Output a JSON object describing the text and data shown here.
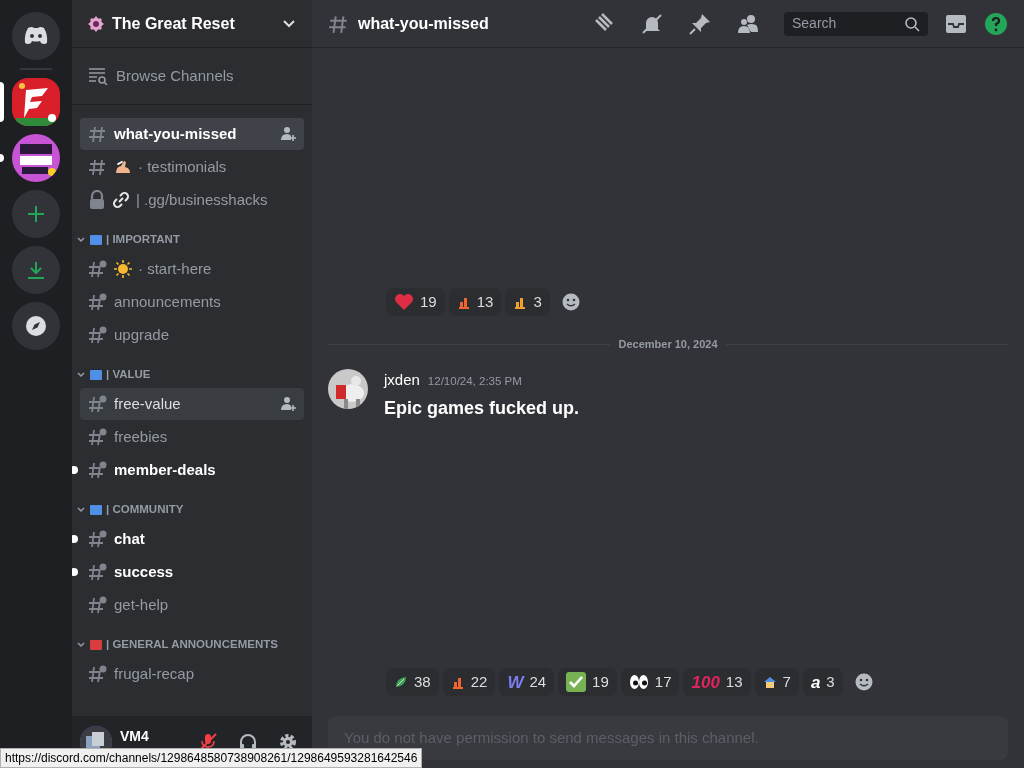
{
  "servers": [
    {
      "kind": "home",
      "selected": false,
      "unread": false
    },
    {
      "kind": "picture",
      "selected": true,
      "unread": false
    },
    {
      "kind": "picture",
      "selected": false,
      "unread": true
    },
    {
      "kind": "add",
      "selected": false,
      "unread": false
    },
    {
      "kind": "download",
      "selected": false,
      "unread": false
    },
    {
      "kind": "explore",
      "selected": false,
      "unread": false
    }
  ],
  "server_name": "The Great Reset",
  "browse": "Browse Channels",
  "sections": [
    {
      "channels": [
        {
          "name": "what-you-missed",
          "kind": "text",
          "selected": true,
          "unread": false,
          "hovered": false
        },
        {
          "name": "· testimonials",
          "kind": "text",
          "emoji": {
            "kind": "hand"
          },
          "selected": false,
          "unread": false,
          "hovered": false
        },
        {
          "name": "| .gg/businesshacks",
          "kind": "locked",
          "emoji": {
            "kind": "link"
          },
          "selected": false,
          "unread": false,
          "hovered": false
        }
      ]
    },
    {
      "category": {
        "name": "| IMPORTANT",
        "color": "#4f8fe6"
      },
      "channels": [
        {
          "name": "· start-here",
          "kind": "thread",
          "emoji": {
            "kind": "sun"
          },
          "selected": false,
          "unread": false,
          "hovered": false
        },
        {
          "name": "announcements",
          "kind": "thread",
          "selected": false,
          "unread": false,
          "hovered": false
        },
        {
          "name": "upgrade",
          "kind": "thread",
          "selected": false,
          "unread": false,
          "hovered": false
        }
      ]
    },
    {
      "category": {
        "name": "| VALUE",
        "color": "#4f8fe6"
      },
      "channels": [
        {
          "name": "free-value",
          "kind": "thread",
          "selected": false,
          "unread": false,
          "hovered": true
        },
        {
          "name": "freebies",
          "kind": "thread",
          "selected": false,
          "unread": false,
          "hovered": false
        },
        {
          "name": "member-deals",
          "kind": "thread",
          "selected": false,
          "unread": true,
          "hovered": false
        }
      ]
    },
    {
      "category": {
        "name": "| COMMUNITY",
        "color": "#4f8fe6"
      },
      "channels": [
        {
          "name": "chat",
          "kind": "thread",
          "selected": false,
          "unread": true,
          "hovered": false
        },
        {
          "name": "success",
          "kind": "thread",
          "selected": false,
          "unread": true,
          "hovered": false
        },
        {
          "name": "get-help",
          "kind": "thread",
          "selected": false,
          "unread": false,
          "hovered": false
        }
      ]
    },
    {
      "category": {
        "name": "| GENERAL ANNOUNCEMENTS",
        "color": "#d83c3e"
      },
      "channels": [
        {
          "name": "frugal-recap",
          "kind": "thread",
          "selected": false,
          "unread": false,
          "hovered": false
        }
      ]
    }
  ],
  "user": {
    "name": "VM4",
    "mic_muted": true
  },
  "status_url": "https://discord.com/channels/1298648580738908261/1298649593281642546",
  "header": {
    "channel": "what-you-missed",
    "search_placeholder": "Search"
  },
  "first_reactions": [
    {
      "kind": "heart",
      "count": "19"
    },
    {
      "kind": "bars",
      "count": "13",
      "color": "#f0642e"
    },
    {
      "kind": "bars",
      "count": "3",
      "color": "#f0a030"
    }
  ],
  "date_divider": "December 10, 2024",
  "message": {
    "author": "jxden",
    "time": "12/10/24, 2:35 PM",
    "text": "Epic games fucked up."
  },
  "reactions": [
    {
      "kind": "leaf",
      "count": "38"
    },
    {
      "kind": "bars",
      "count": "22",
      "color": "#f0642e"
    },
    {
      "kind": "letter",
      "text": "W",
      "color": "#7b7ff0",
      "count": "24"
    },
    {
      "kind": "check",
      "count": "19"
    },
    {
      "kind": "eyes",
      "count": "17"
    },
    {
      "kind": "letter",
      "text": "100",
      "color": "#e0245e",
      "count": "13"
    },
    {
      "kind": "house",
      "count": "7"
    },
    {
      "kind": "letter",
      "text": "a",
      "color": "#ffffff",
      "count": "3"
    }
  ],
  "composer_notice": "You do not have permission to send messages in this channel."
}
